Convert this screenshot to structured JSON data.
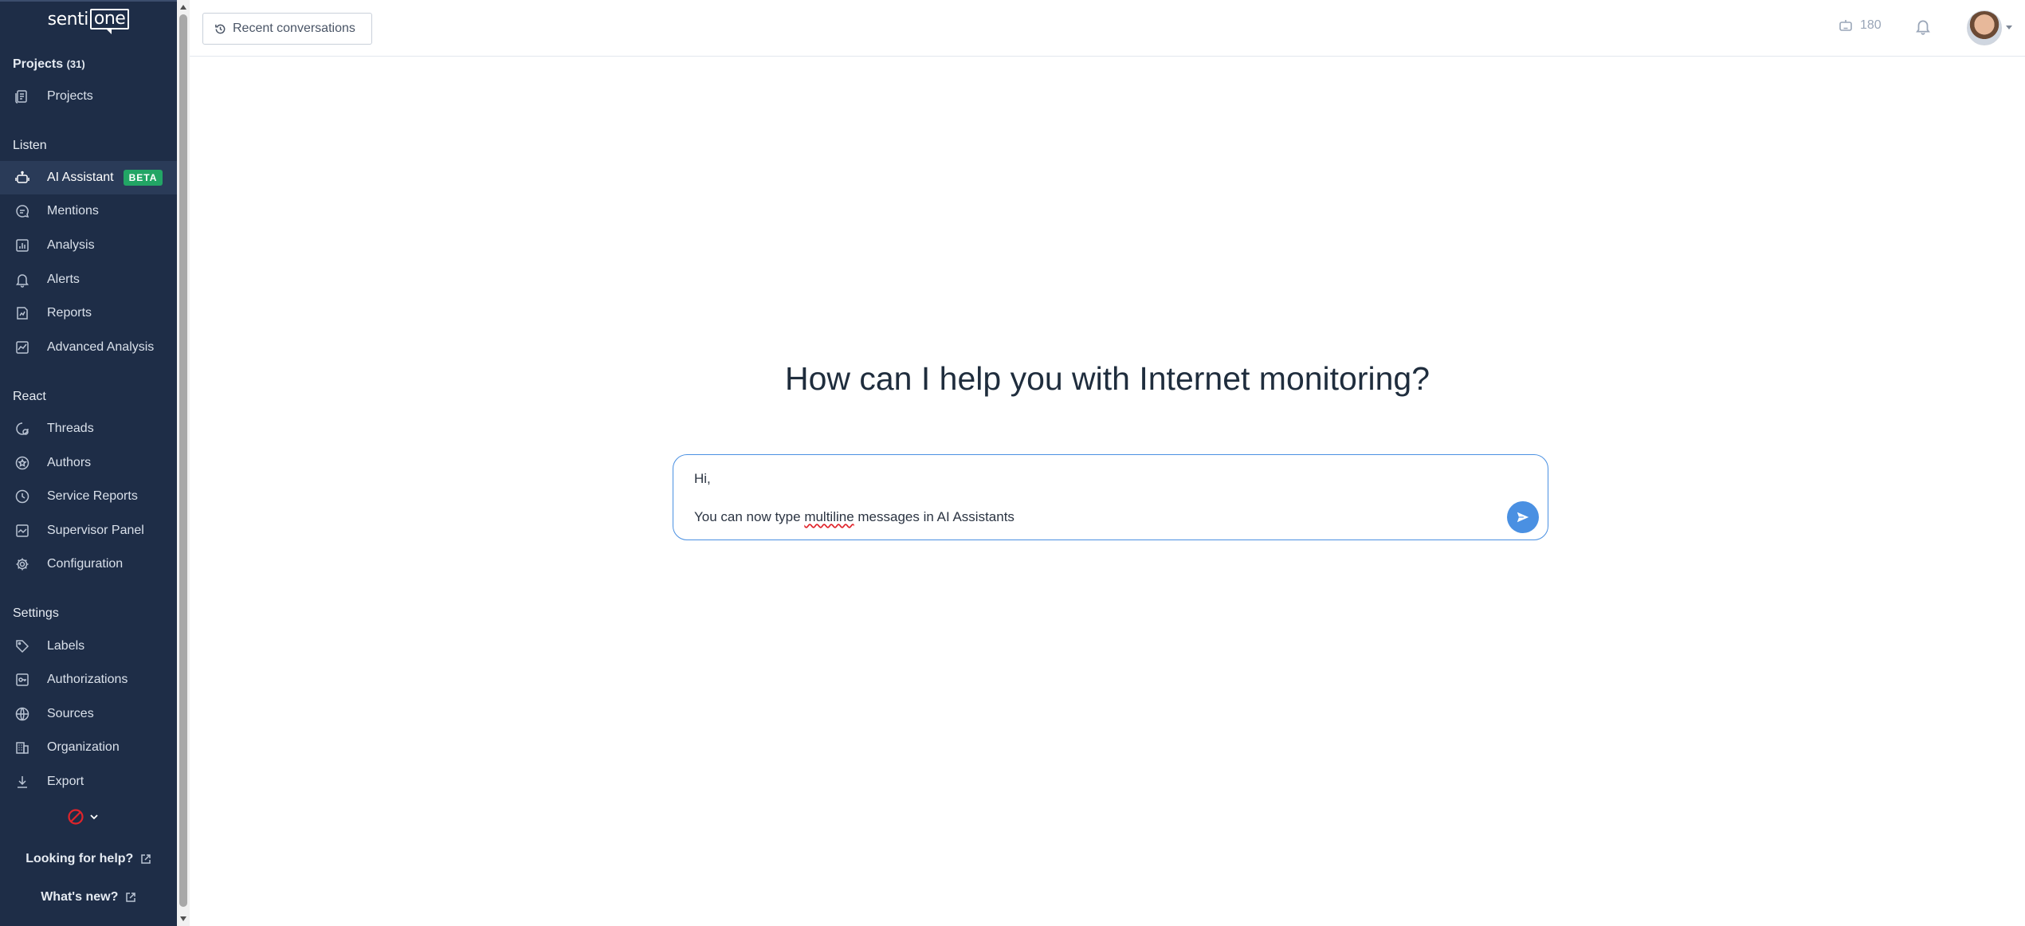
{
  "app": {
    "logo_left": "senti",
    "logo_right": "one"
  },
  "sidebar": {
    "projects_header": "Projects",
    "projects_count": "(31)",
    "projects_item": "Projects",
    "listen_label": "Listen",
    "listen_items": [
      {
        "label": "AI Assistant",
        "icon": "robot-icon",
        "badge": "BETA",
        "active": true
      },
      {
        "label": "Mentions",
        "icon": "chat-icon"
      },
      {
        "label": "Analysis",
        "icon": "bar-chart-icon"
      },
      {
        "label": "Alerts",
        "icon": "bell-icon"
      },
      {
        "label": "Reports",
        "icon": "report-icon"
      },
      {
        "label": "Advanced Analysis",
        "icon": "line-chart-icon"
      }
    ],
    "react_label": "React",
    "react_items": [
      {
        "label": "Threads",
        "icon": "threads-icon"
      },
      {
        "label": "Authors",
        "icon": "star-circle-icon"
      },
      {
        "label": "Service Reports",
        "icon": "clock-icon"
      },
      {
        "label": "Supervisor Panel",
        "icon": "trend-icon"
      },
      {
        "label": "Configuration",
        "icon": "gear-icon"
      }
    ],
    "settings_label": "Settings",
    "settings_items": [
      {
        "label": "Labels",
        "icon": "tag-icon"
      },
      {
        "label": "Authorizations",
        "icon": "key-icon"
      },
      {
        "label": "Sources",
        "icon": "globe-icon"
      },
      {
        "label": "Organization",
        "icon": "building-icon"
      },
      {
        "label": "Export",
        "icon": "download-icon"
      }
    ],
    "help_link": "Looking for help?",
    "whats_new_link": "What's new?"
  },
  "topbar": {
    "recent_conversations": "Recent conversations",
    "credits_value": "180"
  },
  "main": {
    "headline": "How can I help you with Internet monitoring?",
    "composer": {
      "line1": "Hi,",
      "line2_before": "You can now type ",
      "line2_misspelled": "multiline",
      "line2_after": " messages in AI Assistants"
    }
  },
  "colors": {
    "sidebar_bg": "#1e2d47",
    "accent": "#4a90e2",
    "beta_badge": "#22a565",
    "language_icon": "#e0242b"
  }
}
